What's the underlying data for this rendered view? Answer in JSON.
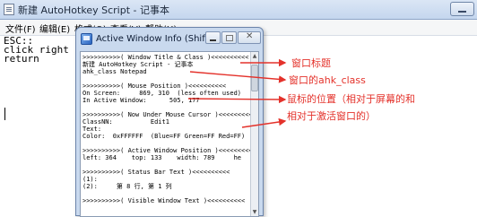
{
  "notepad": {
    "title": "新建 AutoHotkey Script - 记事本",
    "menu": [
      "文件(F)",
      "编辑(E)",
      "格式(O)",
      "查看(V)",
      "帮助(H)"
    ],
    "lines": [
      "ESC::",
      "click right",
      "return"
    ]
  },
  "awi": {
    "title": "Active Window Info (Shift-...",
    "lines": [
      ">>>>>>>>>>( Window Title & Class )<<<<<<<<<<",
      "新建 AutoHotkey Script - 记事本",
      "ahk_class Notepad",
      "",
      ">>>>>>>>>>( Mouse Position )<<<<<<<<<<",
      "On Screen:     869, 310  (less often used)",
      "In Active Window:      505, 177",
      "",
      ">>>>>>>>>>( Now Under Mouse Cursor )<<<<<<<<<",
      "ClassNN:          Edit1",
      "Text:",
      "Color:  0xFFFFFF  (Blue=FF Green=FF Red=FF)",
      "",
      ">>>>>>>>>>( Active Window Position )<<<<<<<<<",
      "left: 364    top: 133    width: 789     he",
      "",
      ">>>>>>>>>>( Status Bar Text )<<<<<<<<<<",
      "(1):",
      "(2):     第 8 行, 第 1 列",
      "",
      ">>>>>>>>>>( Visible Window Text )<<<<<<<<<<"
    ]
  },
  "annotations": [
    "窗口标题",
    "窗口的ahk_class",
    "鼠标的位置（相对于屏幕的和",
    "相对于激活窗口的）"
  ],
  "annotation_color": "#e4322b"
}
